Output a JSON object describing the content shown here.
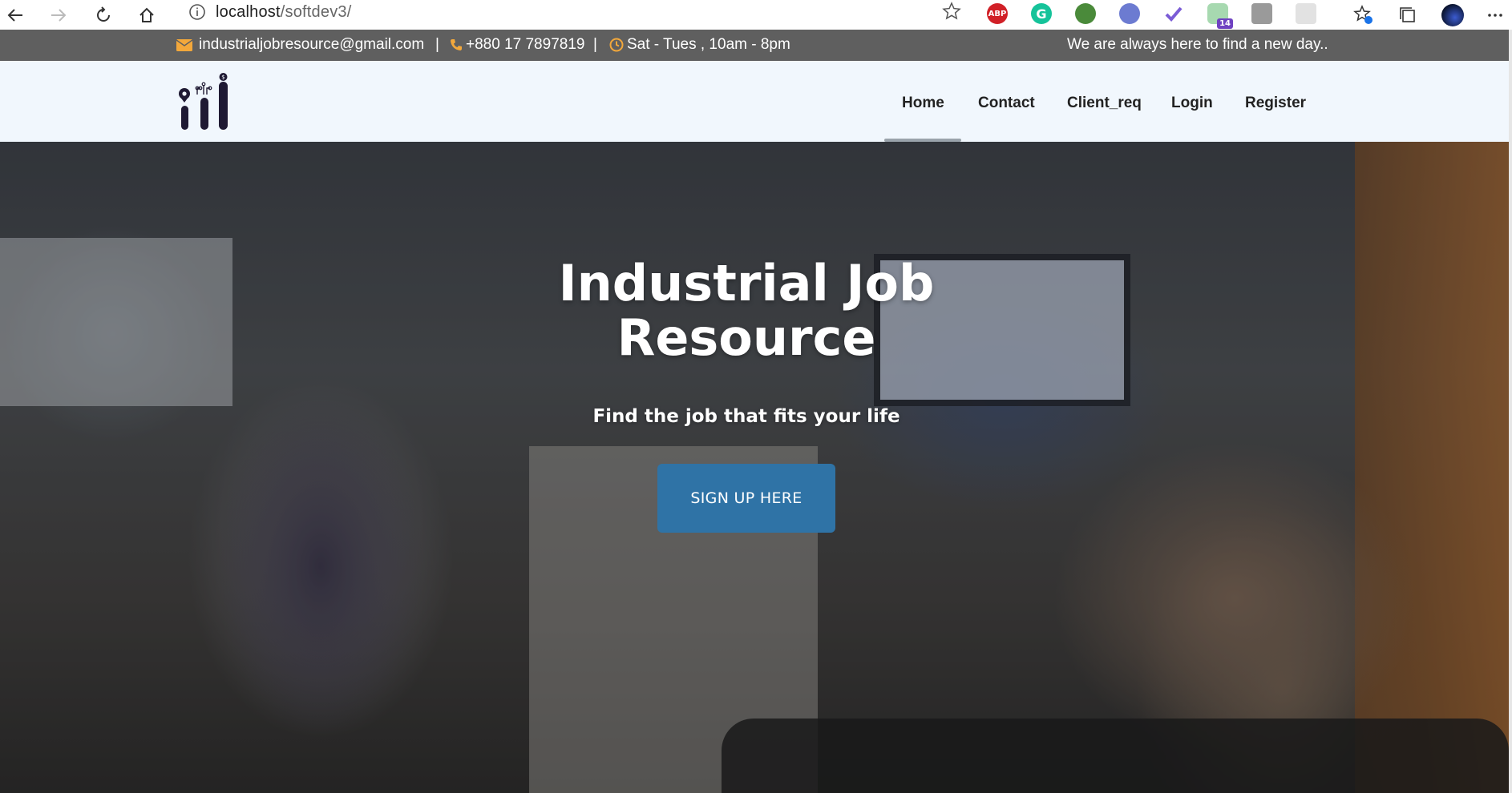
{
  "browser": {
    "url_host": "localhost",
    "url_path": "/softdev3/",
    "extensions": [
      {
        "name": "adblock-icon",
        "label": "ABP",
        "color": "#d12027"
      },
      {
        "name": "grammarly-icon",
        "label": "G",
        "color": "#15c39a"
      },
      {
        "name": "globe-extension-icon",
        "label": "",
        "color": "#4a8a3a"
      },
      {
        "name": "owl-extension-icon",
        "label": "",
        "color": "#6c7bd1"
      },
      {
        "name": "check-extension-icon",
        "label": "",
        "color": "#7b5cd6"
      },
      {
        "name": "badge-extension-icon",
        "label": "14",
        "color": "#6f42c1"
      },
      {
        "name": "person-extension-icon",
        "label": "",
        "color": "#9a9a9a"
      },
      {
        "name": "blank-extension-icon",
        "label": "",
        "color": "#dcdcdc"
      }
    ]
  },
  "topbar": {
    "email": "industrialjobresource@gmail.com",
    "phone": "+880 17 7897819",
    "hours": "Sat - Tues , 10am - 8pm",
    "separator": "|",
    "tagline": "We are always here to find a new day.."
  },
  "nav": {
    "items": [
      {
        "label": "Home",
        "active": true
      },
      {
        "label": "Contact"
      },
      {
        "label": "Client_req"
      },
      {
        "label": "Login"
      },
      {
        "label": "Register"
      }
    ]
  },
  "hero": {
    "title_line1": "Industrial Job",
    "title_line2": "Resource",
    "subtitle": "Find the job that fits your life",
    "cta_label": "SIGN UP HERE"
  },
  "colors": {
    "accent": "#f3a83b",
    "topbar_bg": "#5f5f5f",
    "header_bg": "#f1f7fd",
    "cta_bg": "#2f73a6"
  }
}
